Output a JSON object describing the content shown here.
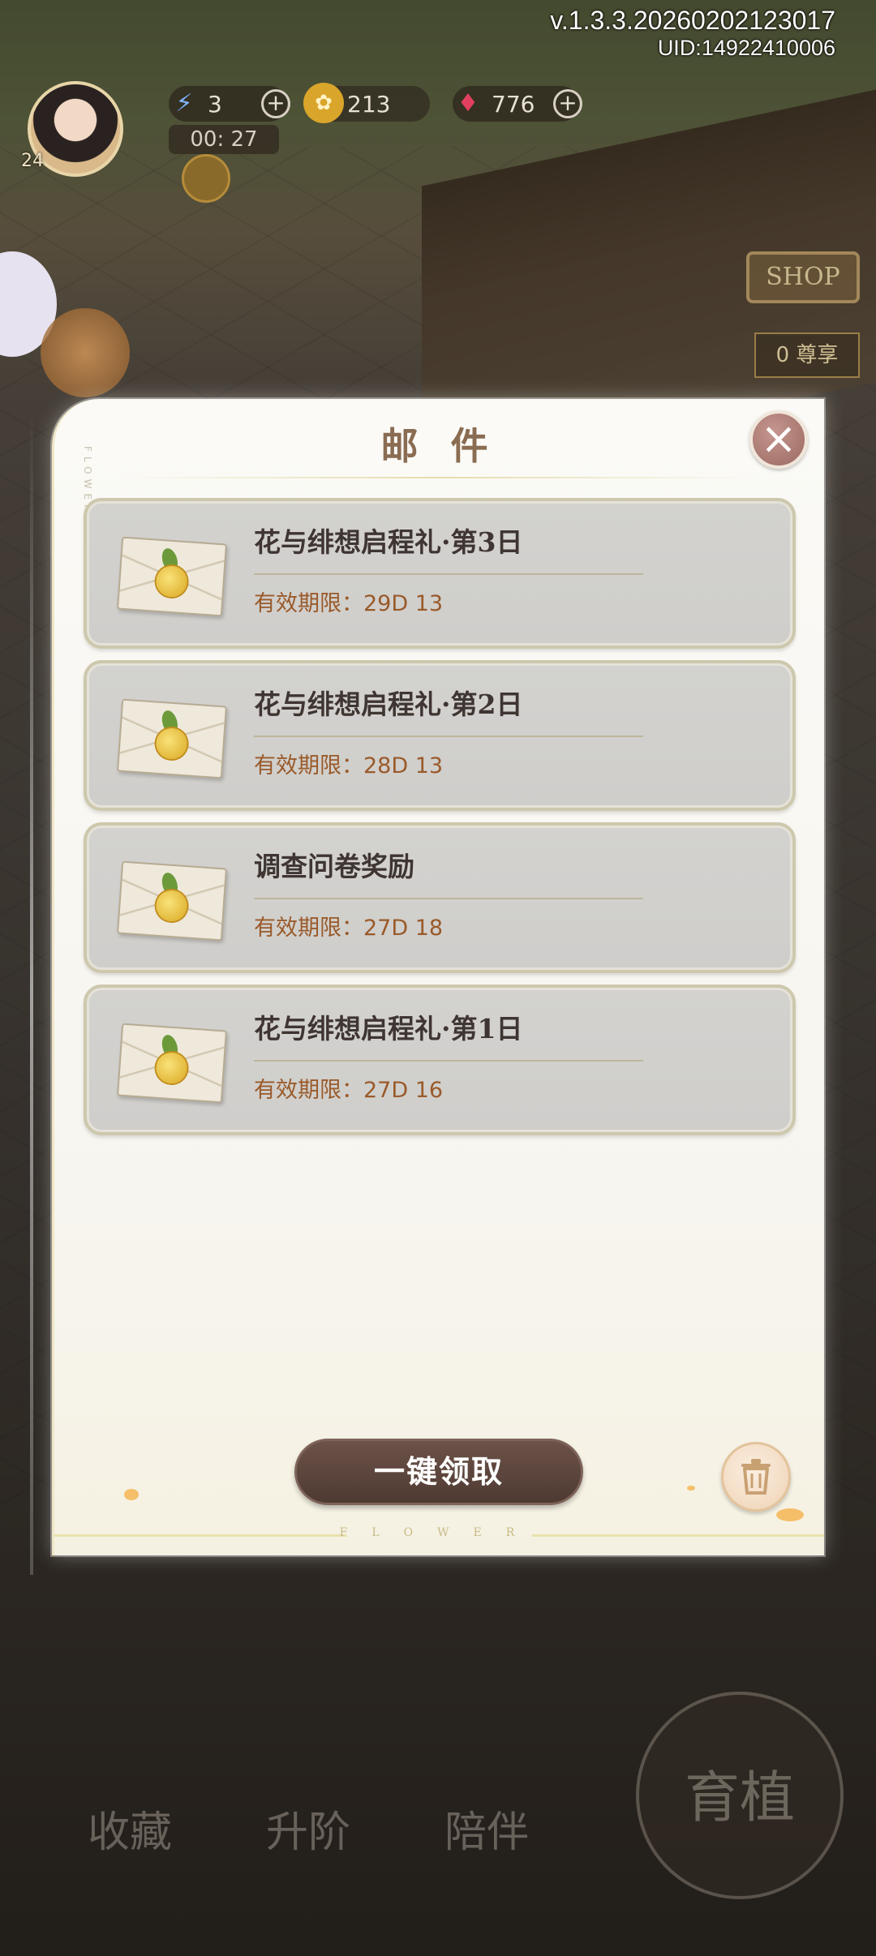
{
  "hud": {
    "version": "v.1.3.3.20260202123017",
    "uid": "UID:14922410006",
    "level": "24",
    "energy": "3",
    "coins": "213",
    "gems": "776",
    "timer": "00: 27",
    "shop_label": "SHOP",
    "shop_tag": "0 尊享"
  },
  "modal": {
    "title": "邮 件",
    "side_deco": "FLOWER",
    "bottom_deco": "FLOWER",
    "claim_all": "一键领取",
    "items": [
      {
        "title": "花与绯想启程礼·第3日",
        "expiry": "有效期限：29D 13"
      },
      {
        "title": "花与绯想启程礼·第2日",
        "expiry": "有效期限：28D 13"
      },
      {
        "title": "调查问卷奖励",
        "expiry": "有效期限：27D 18"
      },
      {
        "title": "花与绯想启程礼·第1日",
        "expiry": "有效期限：27D 16"
      }
    ]
  },
  "nav": {
    "collect": "收藏",
    "upgrade": "升阶",
    "companion": "陪伴",
    "merge": "育植"
  },
  "colors": {
    "title": "#8a6c52",
    "expiry": "#9a5a2a",
    "claim_button": "#5a443b",
    "close_button": "#b07f78"
  }
}
